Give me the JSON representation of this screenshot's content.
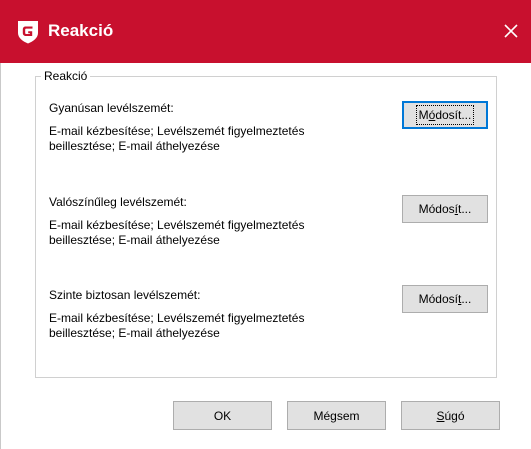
{
  "window": {
    "title": "Reakció",
    "icon": "g-data-shield-icon",
    "accent": "#c8102e"
  },
  "group": {
    "label": "Reakció"
  },
  "sections": [
    {
      "label": "Gyanúsan levélszemét:",
      "desc_line1": "E-mail kézbesítése; Levélszemét figyelmeztetés",
      "desc_line2": "beillesztése; E-mail áthelyezése",
      "button": {
        "pre": "M",
        "accel": "ó",
        "post": "dosít..."
      }
    },
    {
      "label": "Valószínűleg levélszemét:",
      "desc_line1": "E-mail kézbesítése; Levélszemét figyelmeztetés",
      "desc_line2": "beillesztése; E-mail áthelyezése",
      "button": {
        "pre": "Módos",
        "accel": "í",
        "post": "t..."
      }
    },
    {
      "label": "Szinte biztosan levélszemét:",
      "desc_line1": "E-mail kézbesítése; Levélszemét figyelmeztetés",
      "desc_line2": "beillesztése; E-mail áthelyezése",
      "button": {
        "pre": "Módosí",
        "accel": "t",
        "post": "..."
      }
    }
  ],
  "footer": {
    "ok": "OK",
    "cancel": "Mégsem",
    "help_accel": "S",
    "help_rest": "úgó"
  }
}
